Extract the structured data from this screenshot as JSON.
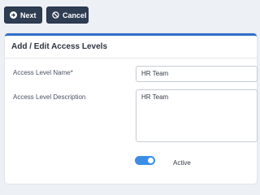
{
  "toolbar": {
    "next_label": "Next",
    "cancel_label": "Cancel"
  },
  "form": {
    "title": "Add / Edit Access Levels",
    "name_label": "Access Level Name*",
    "name_value": "HR Team",
    "description_label": "Access Level Description",
    "description_value": "HR Team",
    "active_label": "Active",
    "active": true
  },
  "colors": {
    "button_bg": "#2f3d52",
    "accent": "#2f6fc7",
    "toggle_on": "#3b8ee6"
  },
  "icons": {
    "next": "arrow-right-circle-icon",
    "cancel": "ban-icon"
  }
}
